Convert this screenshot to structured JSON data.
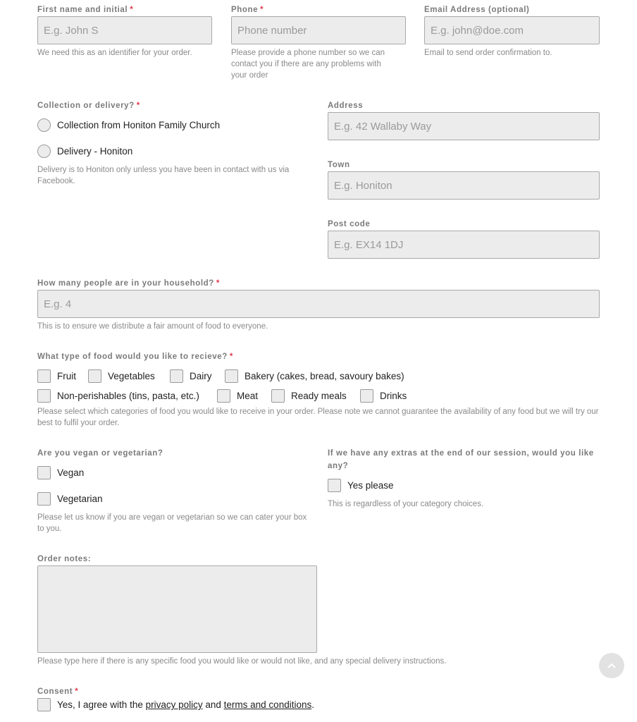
{
  "fields": {
    "first_name": {
      "label": "First name and initial",
      "required": "*",
      "placeholder": "E.g. John S",
      "help": "We need this as an identifier for your order."
    },
    "phone": {
      "label": "Phone",
      "required": "*",
      "placeholder": "Phone number",
      "help": "Please provide a phone number so we can contact you if there are any problems with your order"
    },
    "email": {
      "label": "Email Address (optional)",
      "placeholder": "E.g. john@doe.com",
      "help": "Email to send order confirmation to."
    },
    "collection": {
      "label": "Collection or delivery?",
      "required": "*",
      "options": [
        "Collection from Honiton Family Church",
        "Delivery - Honiton"
      ],
      "help": "Delivery is to Honiton only unless you have been in contact with us via Facebook."
    },
    "address": {
      "label": "Address",
      "placeholder": "E.g. 42 Wallaby Way"
    },
    "town": {
      "label": "Town",
      "placeholder": "E.g. Honiton"
    },
    "postcode": {
      "label": "Post code",
      "placeholder": "E.g. EX14 1DJ"
    },
    "household": {
      "label": "How many people are in your household?",
      "required": "*",
      "placeholder": "E.g. 4",
      "help": "This is to ensure we distribute a fair amount of food to everyone."
    },
    "food_type": {
      "label": "What type of food would you like to recieve?",
      "required": "*",
      "options": [
        "Fruit",
        "Vegetables",
        "Dairy",
        "Bakery (cakes, bread, savoury bakes)",
        "Non-perishables (tins, pasta, etc.)",
        "Meat",
        "Ready meals",
        "Drinks"
      ],
      "help": "Please select which categories of food you would like to receive in your order. Please note we cannot guarantee the availability of any food but we will try our best to fulfil your order."
    },
    "diet": {
      "label": "Are you vegan or vegetarian?",
      "options": [
        "Vegan",
        "Vegetarian"
      ],
      "help": "Please let us know if you are vegan or vegetarian so we can cater your box to you."
    },
    "extras": {
      "label": "If we have any extras at the end of our session, would you like any?",
      "options": [
        "Yes please"
      ],
      "help": "This is regardless of your category choices."
    },
    "notes": {
      "label": "Order notes:",
      "value": "",
      "help": "Please type here if there is any specific food you would like or would not like, and any special delivery instructions."
    },
    "consent": {
      "label": "Consent",
      "required": "*",
      "text_before": "Yes, I agree with the ",
      "privacy_link": "privacy policy",
      "text_middle": " and ",
      "terms_link": "terms and conditions",
      "text_after": "."
    }
  },
  "scroll_top": {
    "icon": "chevron-up-icon"
  }
}
